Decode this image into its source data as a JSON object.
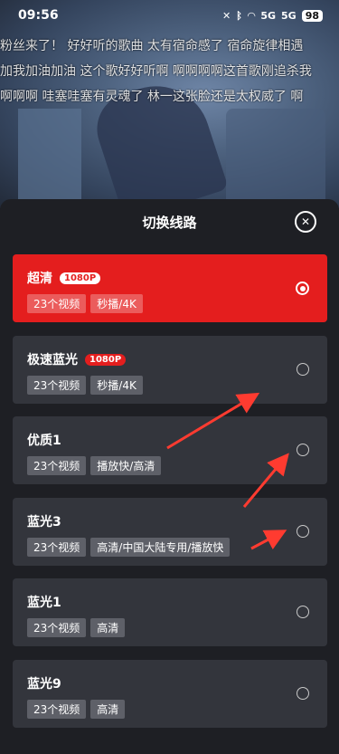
{
  "status": {
    "time": "09:56",
    "battery": "98",
    "signal1": "5G",
    "signal2": "5G"
  },
  "danmaku": [
    "粉丝来了！ 好好听的歌曲 太有宿命感了 宿命旋律相遇",
    "加我加油加油 这个歌好好听啊 啊啊啊啊这首歌刚追杀我",
    "啊啊啊 哇塞哇塞有灵魂了 林一这张脸还是太权威了 啊"
  ],
  "panel": {
    "title": "切换线路",
    "close_icon": "close-icon",
    "routes": [
      {
        "name": "超清",
        "badge": "1080P",
        "tags": [
          "23个视频",
          "秒播/4K"
        ],
        "selected": true
      },
      {
        "name": "极速蓝光",
        "badge": "1080P",
        "tags": [
          "23个视频",
          "秒播/4K"
        ],
        "selected": false
      },
      {
        "name": "优质1",
        "badge": "",
        "tags": [
          "23个视频",
          "播放快/高清"
        ],
        "selected": false
      },
      {
        "name": "蓝光3",
        "badge": "",
        "tags": [
          "23个视频",
          "高清/中国大陆专用/播放快"
        ],
        "selected": false
      },
      {
        "name": "蓝光1",
        "badge": "",
        "tags": [
          "23个视频",
          "高清"
        ],
        "selected": false
      },
      {
        "name": "蓝光9",
        "badge": "",
        "tags": [
          "23个视频",
          "高清"
        ],
        "selected": false
      }
    ]
  },
  "colors": {
    "accent": "#e41e1e",
    "card": "#33353c",
    "panel": "#1e1f24",
    "annotation": "#ff3b30"
  }
}
